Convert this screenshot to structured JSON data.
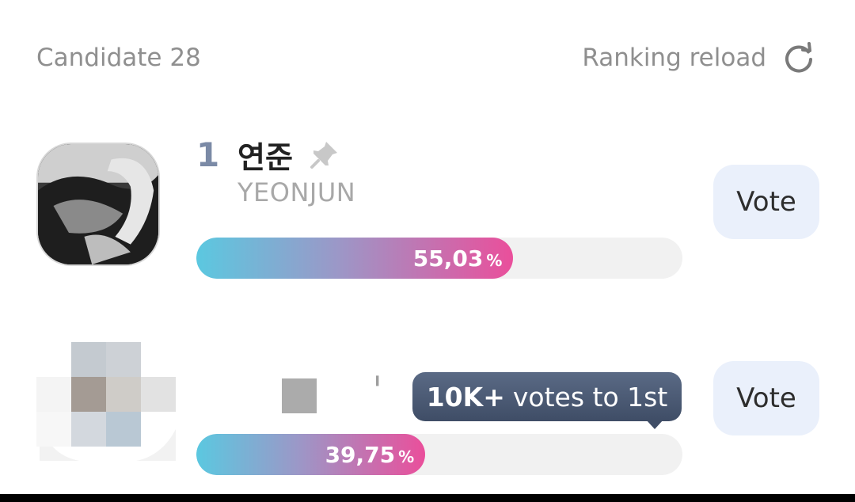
{
  "header": {
    "candidate_label": "Candidate 28",
    "reload_label": "Ranking reload",
    "reload_icon": "reload-icon"
  },
  "candidates": [
    {
      "rank": "1",
      "name_ko": "연준",
      "name_en": "YEONJUN",
      "percent": "55,03",
      "percent_value": 55.03,
      "pct_sign": "%",
      "vote_label": "Vote",
      "pin_icon": "pin-icon"
    },
    {
      "percent": "39,75",
      "percent_value": 39.75,
      "pct_sign": "%",
      "vote_label": "Vote",
      "tooltip_bold": "10K+",
      "tooltip_rest": "votes to 1st"
    }
  ],
  "colors": {
    "bar_gradient_start": "#5bc8e0",
    "bar_gradient_end": "#ea4f9b",
    "vote_button_bg": "#eaf0fb",
    "tooltip_bg": "#4a5873"
  }
}
